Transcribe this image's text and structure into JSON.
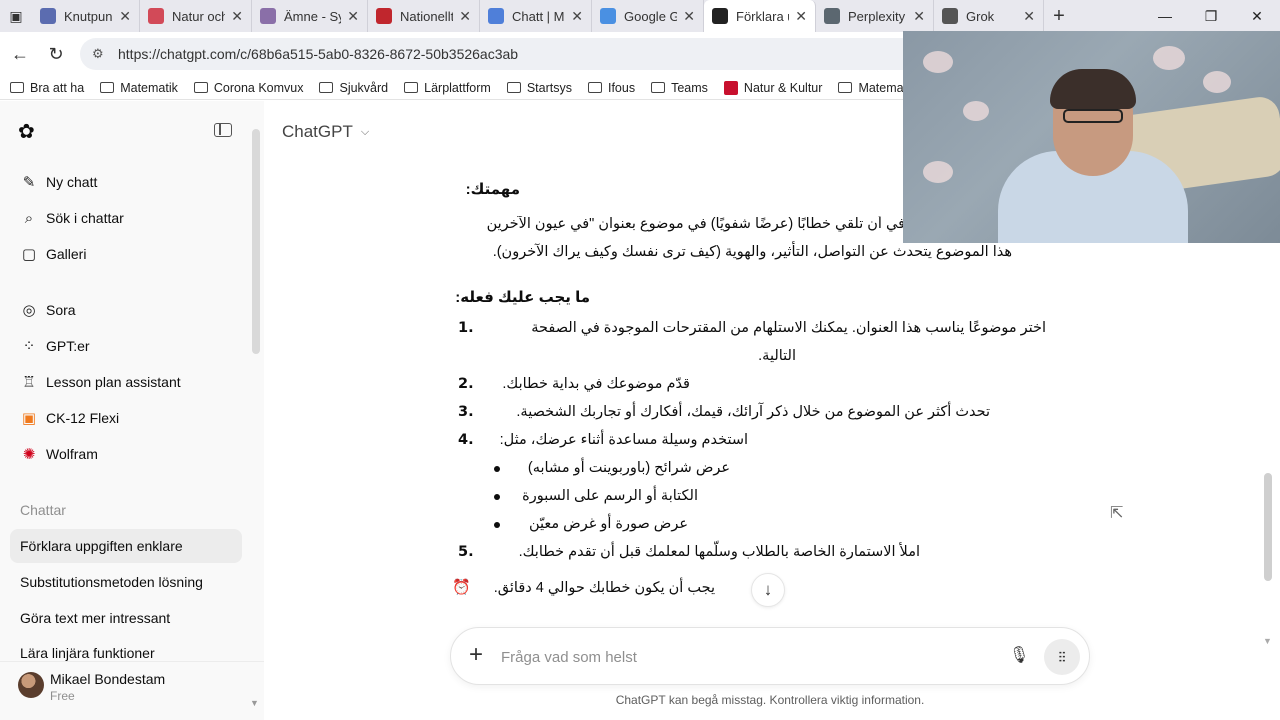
{
  "browser": {
    "tabs": [
      {
        "title": "Knutpunk",
        "fav_color": "#5b6cb0",
        "fav_letter": "K"
      },
      {
        "title": "Natur och",
        "fav_color": "#d24a58",
        "fav_letter": ""
      },
      {
        "title": "Ämne - Sy",
        "fav_color": "#8a6fa8",
        "fav_letter": "S"
      },
      {
        "title": "Nationellt",
        "fav_color": "#c0262d",
        "fav_letter": "PDF"
      },
      {
        "title": "Chatt | M",
        "fav_color": "#4f7fd9",
        "fav_letter": ""
      },
      {
        "title": "Google G",
        "fav_color": "#4a90e2",
        "fav_letter": "✦"
      },
      {
        "title": "Förklara u",
        "fav_color": "#222222",
        "fav_letter": "✿"
      },
      {
        "title": "Perplexity",
        "fav_color": "#5b6770",
        "fav_letter": ""
      },
      {
        "title": "Grok",
        "fav_color": "#555555",
        "fav_letter": ""
      }
    ],
    "url": "https://chatgpt.com/c/68b6a515-5ab0-8326-8672-50b3526ac3ab",
    "bookmarks": [
      {
        "label": "Bra att ha"
      },
      {
        "label": "Matematik"
      },
      {
        "label": "Corona Komvux"
      },
      {
        "label": "Sjukvård"
      },
      {
        "label": "Lärplattform"
      },
      {
        "label": "Startsys"
      },
      {
        "label": "Ifous"
      },
      {
        "label": "Teams"
      },
      {
        "label": "Natur & Kultur"
      },
      {
        "label": "Matemat"
      }
    ]
  },
  "sidebar": {
    "nav": [
      {
        "label": "Ny chatt",
        "icon": "✎"
      },
      {
        "label": "Sök i chattar",
        "icon": "⌕"
      },
      {
        "label": "Galleri",
        "icon": "▢"
      }
    ],
    "gpts": [
      {
        "label": "Sora",
        "icon": "◎"
      },
      {
        "label": "GPT:er",
        "icon": "⁘"
      },
      {
        "label": "Lesson plan assistant",
        "icon": "♖"
      },
      {
        "label": "CK-12 Flexi",
        "icon": "▣"
      },
      {
        "label": "Wolfram",
        "icon": "✺"
      }
    ],
    "section_label": "Chattar",
    "chats": [
      {
        "label": "Förklara uppgiften enklare"
      },
      {
        "label": "Substitutionsmetoden lösning"
      },
      {
        "label": "Göra text mer intressant"
      },
      {
        "label": "Lära linjära funktioner"
      }
    ],
    "user": {
      "name": "Mikael Bondestam",
      "plan": "Free"
    }
  },
  "main": {
    "model_label": "ChatGPT",
    "heading_task": "مهمتك:",
    "p1_line1": "في أن تلقي خطابًا (عرضًا شفويًا) في موضوع بعنوان \"في عيون الآخرين",
    "p1_line2": "هذا الموضوع يتحدث عن التواصل، التأثير، والهوية (كيف ترى نفسك وكيف يراك الآخرون).",
    "heading_todo": "ما يجب عليك فعله:",
    "steps": [
      {
        "num": "1.",
        "line1": "اختر موضوعًا يناسب هذا العنوان. يمكنك الاستلهام من المقترحات الموجودة في الصفحة",
        "line2": "التالية."
      },
      {
        "num": "2.",
        "line1": "قدّم موضوعك في بداية خطابك."
      },
      {
        "num": "3.",
        "line1": "تحدث أكثر عن الموضوع من خلال ذكر آرائك، قيمك، أفكارك أو تجاربك الشخصية."
      },
      {
        "num": "4.",
        "line1": "استخدم وسيلة مساعدة أثناء عرضك، مثل:"
      },
      {
        "num": "5.",
        "line1": "املأ الاستمارة الخاصة بالطلاب وسلّمها لمعلمك قبل أن تقدم خطابك."
      }
    ],
    "sub_items": [
      {
        "text": "عرض شرائح (باوربوينت أو مشابه)"
      },
      {
        "text": "الكتابة أو الرسم على السبورة"
      },
      {
        "text": "عرض صورة أو غرض معيّن"
      }
    ],
    "time_note": "يجب أن يكون خطابك حوالي 4 دقائق.",
    "alarm_icon": "⏰",
    "composer_placeholder": "Fråga vad som helst",
    "disclaimer": "ChatGPT kan begå misstag. Kontrollera viktig information."
  }
}
